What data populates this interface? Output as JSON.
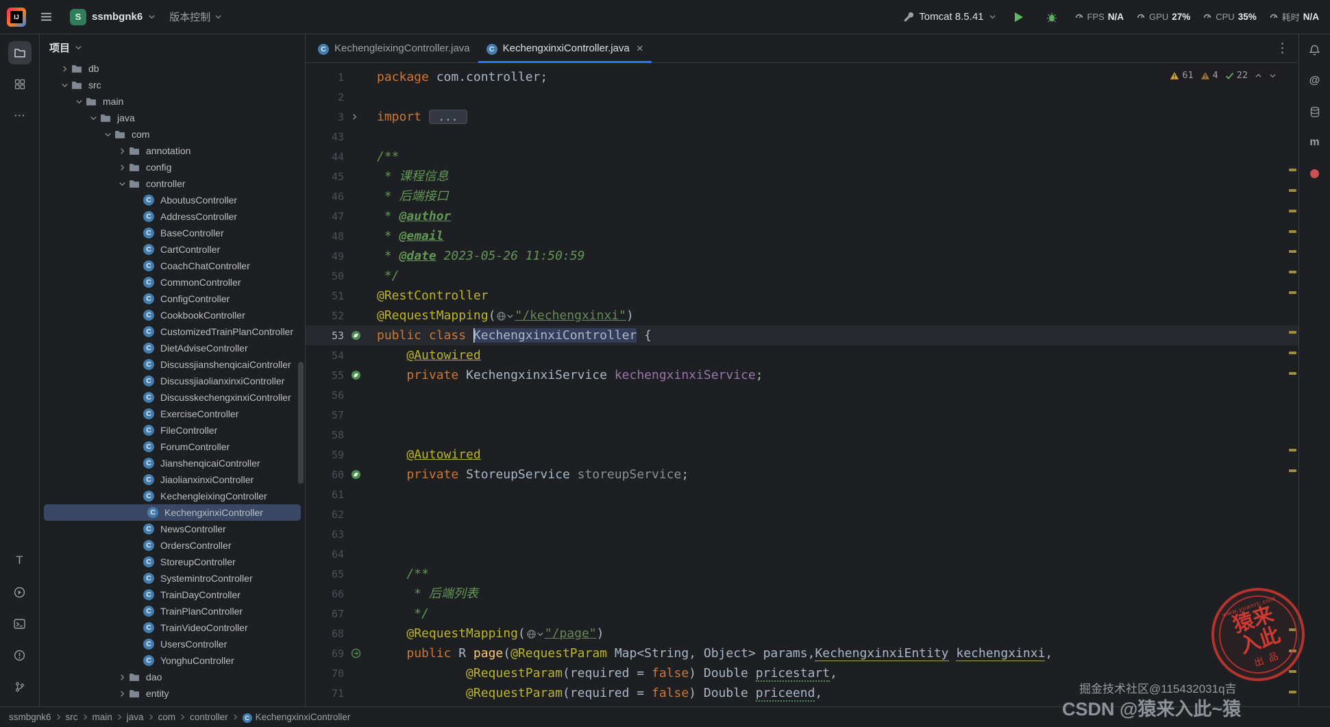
{
  "icons": {
    "logo": "IJ",
    "class_letter": "C",
    "at": "@",
    "maven": "m",
    "translate": "T",
    "more_h": "⋯",
    "more_v": "⋮",
    "close": "×"
  },
  "topbar": {
    "project_name": "ssmbgnk6",
    "project_avatar_letter": "S",
    "vcs_label": "版本控制",
    "tomcat_label": "Tomcat 8.5.41",
    "metrics": [
      {
        "label": "FPS",
        "value": "N/A"
      },
      {
        "label": "GPU",
        "value": "27%"
      },
      {
        "label": "CPU",
        "value": "35%"
      },
      {
        "label": "耗时",
        "value": "N/A"
      }
    ]
  },
  "project_panel": {
    "title": "项目"
  },
  "tree": {
    "items": [
      {
        "label": "db",
        "depth": 1,
        "chevron": "collapsed",
        "icon": "folder"
      },
      {
        "label": "src",
        "depth": 1,
        "chevron": "expanded",
        "icon": "folder"
      },
      {
        "label": "main",
        "depth": 2,
        "chevron": "expanded",
        "icon": "folder"
      },
      {
        "label": "java",
        "depth": 3,
        "chevron": "expanded",
        "icon": "folder"
      },
      {
        "label": "com",
        "depth": 4,
        "chevron": "expanded",
        "icon": "folder"
      },
      {
        "label": "annotation",
        "depth": 5,
        "chevron": "collapsed",
        "icon": "folder"
      },
      {
        "label": "config",
        "depth": 5,
        "chevron": "collapsed",
        "icon": "folder"
      },
      {
        "label": "controller",
        "depth": 5,
        "chevron": "expanded",
        "icon": "folder"
      },
      {
        "label": "AboutusController",
        "depth": 6,
        "icon": "class"
      },
      {
        "label": "AddressController",
        "depth": 6,
        "icon": "class"
      },
      {
        "label": "BaseController",
        "depth": 6,
        "icon": "class"
      },
      {
        "label": "CartController",
        "depth": 6,
        "icon": "class"
      },
      {
        "label": "CoachChatController",
        "depth": 6,
        "icon": "class"
      },
      {
        "label": "CommonController",
        "depth": 6,
        "icon": "class"
      },
      {
        "label": "ConfigController",
        "depth": 6,
        "icon": "class"
      },
      {
        "label": "CookbookController",
        "depth": 6,
        "icon": "class"
      },
      {
        "label": "CustomizedTrainPlanController",
        "depth": 6,
        "icon": "class"
      },
      {
        "label": "DietAdviseController",
        "depth": 6,
        "icon": "class"
      },
      {
        "label": "DiscussjianshenqicaiController",
        "depth": 6,
        "icon": "class"
      },
      {
        "label": "DiscussjiaolianxinxiController",
        "depth": 6,
        "icon": "class"
      },
      {
        "label": "DiscusskechengxinxiController",
        "depth": 6,
        "icon": "class"
      },
      {
        "label": "ExerciseController",
        "depth": 6,
        "icon": "class"
      },
      {
        "label": "FileController",
        "depth": 6,
        "icon": "class"
      },
      {
        "label": "ForumController",
        "depth": 6,
        "icon": "class"
      },
      {
        "label": "JianshenqicaiController",
        "depth": 6,
        "icon": "class"
      },
      {
        "label": "JiaolianxinxiController",
        "depth": 6,
        "icon": "class"
      },
      {
        "label": "KechengleixingController",
        "depth": 6,
        "icon": "class"
      },
      {
        "label": "KechengxinxiController",
        "depth": 6,
        "icon": "class",
        "selected": true
      },
      {
        "label": "NewsController",
        "depth": 6,
        "icon": "class"
      },
      {
        "label": "OrdersController",
        "depth": 6,
        "icon": "class"
      },
      {
        "label": "StoreupController",
        "depth": 6,
        "icon": "class"
      },
      {
        "label": "SystemintroController",
        "depth": 6,
        "icon": "class"
      },
      {
        "label": "TrainDayController",
        "depth": 6,
        "icon": "class"
      },
      {
        "label": "TrainPlanController",
        "depth": 6,
        "icon": "class"
      },
      {
        "label": "TrainVideoController",
        "depth": 6,
        "icon": "class"
      },
      {
        "label": "UsersController",
        "depth": 6,
        "icon": "class"
      },
      {
        "label": "YonghuController",
        "depth": 6,
        "icon": "class"
      },
      {
        "label": "dao",
        "depth": 5,
        "chevron": "collapsed",
        "icon": "folder"
      },
      {
        "label": "entity",
        "depth": 5,
        "chevron": "collapsed",
        "icon": "folder"
      }
    ]
  },
  "tabs": [
    {
      "label": "KechengleixingController.java",
      "active": false
    },
    {
      "label": "KechengxinxiController.java",
      "active": true,
      "closable": true
    }
  ],
  "inspection": {
    "warnings": "61",
    "weak_warnings": "4",
    "passed": "22"
  },
  "editor": {
    "lines": [
      {
        "num": "1",
        "tokens": [
          {
            "t": "package ",
            "c": "k"
          },
          {
            "t": "com.controller;",
            "c": "d"
          }
        ]
      },
      {
        "num": "2",
        "tokens": []
      },
      {
        "num": "3",
        "fold": true,
        "tokens": [
          {
            "t": "import ",
            "c": "k"
          },
          {
            "t": " ... ",
            "c": "fold"
          }
        ]
      },
      {
        "num": "43",
        "tokens": []
      },
      {
        "num": "44",
        "tokens": [
          {
            "t": "/**",
            "c": "c"
          }
        ]
      },
      {
        "num": "45",
        "tokens": [
          {
            "t": " * 课程信息",
            "c": "c"
          }
        ]
      },
      {
        "num": "46",
        "tokens": [
          {
            "t": " * 后端接口",
            "c": "c"
          }
        ]
      },
      {
        "num": "47",
        "tokens": [
          {
            "t": " * ",
            "c": "c"
          },
          {
            "t": "@author",
            "c": "ct",
            "u": "link"
          }
        ]
      },
      {
        "num": "48",
        "tokens": [
          {
            "t": " * ",
            "c": "c"
          },
          {
            "t": "@email",
            "c": "ct",
            "u": "link"
          }
        ]
      },
      {
        "num": "49",
        "tokens": [
          {
            "t": " * ",
            "c": "c"
          },
          {
            "t": "@date",
            "c": "ct",
            "u": "link"
          },
          {
            "t": " 2023-05-26 11:50:59",
            "c": "c"
          }
        ]
      },
      {
        "num": "50",
        "tokens": [
          {
            "t": " */",
            "c": "c"
          }
        ]
      },
      {
        "num": "51",
        "tokens": [
          {
            "t": "@RestController",
            "c": "a"
          }
        ]
      },
      {
        "num": "52",
        "tokens": [
          {
            "t": "@RequestMapping",
            "c": "a"
          },
          {
            "t": "(",
            "c": "d"
          },
          {
            "ic": "globe"
          },
          {
            "t": "\"/kechengxinxi\"",
            "c": "s",
            "u": "link"
          },
          {
            "t": ")",
            "c": "d"
          }
        ]
      },
      {
        "num": "53",
        "caret": true,
        "gutter": "bean",
        "tokens": [
          {
            "t": "public class ",
            "c": "k"
          },
          {
            "t": "KechengxinxiController",
            "c": "d",
            "hl": true
          },
          {
            "t": " {",
            "c": "d"
          }
        ]
      },
      {
        "num": "54",
        "tokens": [
          {
            "t": "    ",
            "c": "d"
          },
          {
            "t": "@Autowired",
            "c": "a",
            "u": "link"
          }
        ]
      },
      {
        "num": "55",
        "gutter": "bean",
        "tokens": [
          {
            "t": "    ",
            "c": "d"
          },
          {
            "t": "private ",
            "c": "k"
          },
          {
            "t": "KechengxinxiService ",
            "c": "d"
          },
          {
            "t": "kechengxinxiService",
            "c": "f"
          },
          {
            "t": ";",
            "c": "d"
          }
        ]
      },
      {
        "num": "56",
        "tokens": []
      },
      {
        "num": "57",
        "tokens": []
      },
      {
        "num": "58",
        "tokens": []
      },
      {
        "num": "59",
        "tokens": [
          {
            "t": "    ",
            "c": "d"
          },
          {
            "t": "@Autowired",
            "c": "a",
            "u": "link"
          }
        ]
      },
      {
        "num": "60",
        "gutter": "bean",
        "tokens": [
          {
            "t": "    ",
            "c": "d"
          },
          {
            "t": "private ",
            "c": "k"
          },
          {
            "t": "StoreupService ",
            "c": "d"
          },
          {
            "t": "storeupService",
            "c": "x"
          },
          {
            "t": ";",
            "c": "d"
          }
        ]
      },
      {
        "num": "61",
        "tokens": []
      },
      {
        "num": "62",
        "tokens": []
      },
      {
        "num": "63",
        "tokens": []
      },
      {
        "num": "64",
        "tokens": []
      },
      {
        "num": "65",
        "tokens": [
          {
            "t": "    /**",
            "c": "c"
          }
        ]
      },
      {
        "num": "66",
        "tokens": [
          {
            "t": "     * 后端列表",
            "c": "c"
          }
        ]
      },
      {
        "num": "67",
        "tokens": [
          {
            "t": "     */",
            "c": "c"
          }
        ]
      },
      {
        "num": "68",
        "tokens": [
          {
            "t": "    ",
            "c": "d"
          },
          {
            "t": "@RequestMapping",
            "c": "a"
          },
          {
            "t": "(",
            "c": "d"
          },
          {
            "ic": "globe"
          },
          {
            "t": "\"/page\"",
            "c": "s",
            "u": "link"
          },
          {
            "t": ")",
            "c": "d"
          }
        ]
      },
      {
        "num": "69",
        "gutter": "mapping",
        "tokens": [
          {
            "t": "    ",
            "c": "d"
          },
          {
            "t": "public ",
            "c": "k"
          },
          {
            "t": "R ",
            "c": "d"
          },
          {
            "t": "page",
            "c": "m"
          },
          {
            "t": "(",
            "c": "d"
          },
          {
            "t": "@RequestParam",
            "c": "a"
          },
          {
            "t": " Map<String, Object> params,",
            "c": "d"
          },
          {
            "t": "KechengxinxiEntity",
            "c": "d",
            "u": "warn"
          },
          {
            "t": " ",
            "c": "d"
          },
          {
            "t": "kechengxinxi",
            "c": "d",
            "u": "warn"
          },
          {
            "t": ",",
            "c": "d"
          }
        ]
      },
      {
        "num": "70",
        "tokens": [
          {
            "t": "            ",
            "c": "d"
          },
          {
            "t": "@RequestParam",
            "c": "a"
          },
          {
            "t": "(required = ",
            "c": "d"
          },
          {
            "t": "false",
            "c": "k"
          },
          {
            "t": ") ",
            "c": "d"
          },
          {
            "t": "Double ",
            "c": "d"
          },
          {
            "t": "pricestart",
            "c": "d",
            "u": "typo"
          },
          {
            "t": ",",
            "c": "d"
          }
        ]
      },
      {
        "num": "71",
        "tokens": [
          {
            "t": "            ",
            "c": "d"
          },
          {
            "t": "@RequestParam",
            "c": "a"
          },
          {
            "t": "(required = ",
            "c": "d"
          },
          {
            "t": "false",
            "c": "k"
          },
          {
            "t": ") ",
            "c": "d"
          },
          {
            "t": "Double ",
            "c": "d"
          },
          {
            "t": "priceend",
            "c": "d",
            "u": "typo"
          },
          {
            "t": ",",
            "c": "d"
          }
        ]
      }
    ],
    "stripe_marks": [
      154,
      184,
      214,
      244,
      273,
      303,
      333,
      391,
      421,
      451,
      563,
      593,
      825,
      856,
      886,
      916
    ]
  },
  "breadcrumbs": [
    "ssmbgnk6",
    "src",
    "main",
    "java",
    "com",
    "controller",
    "KechengxinxiController"
  ],
  "watermarks": {
    "juejin": "掘金技术社区@115432031q吉",
    "csdn": "CSDN @猿来入此~猿",
    "stamp_url": "www.yuanrc.com",
    "stamp_main": "猿来入此",
    "stamp_sub": "出品"
  }
}
